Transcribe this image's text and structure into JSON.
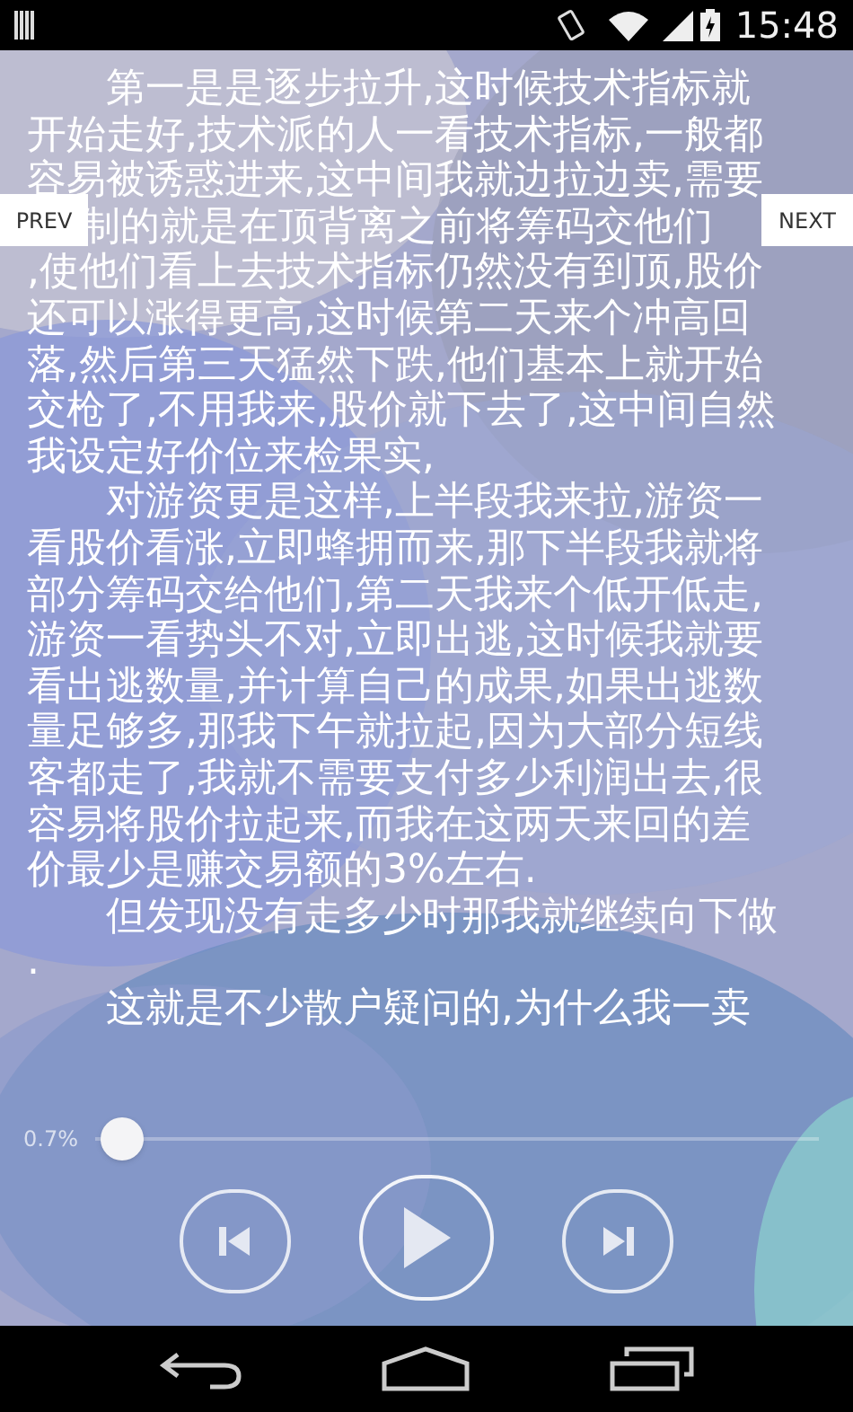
{
  "status_bar": {
    "time": "15:48"
  },
  "paragraphs": [
    {
      "lines": [
        {
          "kind": "line",
          "text": "第一是是逐步拉升,这时候技术指标就"
        },
        {
          "kind": "line",
          "text": "开始走好,技术派的人一看技术指标,一般都"
        },
        {
          "kind": "line",
          "text": "容易被诱惑进来,这中间我就边拉边卖,需要"
        },
        {
          "kind": "covered_line",
          "text": "制的就是在顶背离之前将筹码交他们"
        },
        {
          "kind": "line",
          "text": ",使他们看上去技术指标仍然没有到顶,股价"
        },
        {
          "kind": "line",
          "text": "还可以涨得更高,这时候第二天来个冲高回"
        },
        {
          "kind": "line",
          "text": "落,然后第三天猛然下跌,他们基本上就开始"
        },
        {
          "kind": "line",
          "text": "交枪了,不用我来,股价就下去了,这中间自然"
        },
        {
          "kind": "line",
          "text": "我设定好价位来检果实,"
        }
      ]
    },
    {
      "lines": [
        {
          "kind": "line",
          "text": "对游资更是这样,上半段我来拉,游资一"
        },
        {
          "kind": "line",
          "text": "看股价看涨,立即蜂拥而来,那下半段我就将"
        },
        {
          "kind": "line",
          "text": "部分筹码交给他们,第二天我来个低开低走,"
        },
        {
          "kind": "line",
          "text": "游资一看势头不对,立即出逃,这时候我就要"
        },
        {
          "kind": "line",
          "text": "看出逃数量,并计算自己的成果,如果出逃数"
        },
        {
          "kind": "line",
          "text": "量足够多,那我下午就拉起,因为大部分短线"
        },
        {
          "kind": "line",
          "text": "客都走了,我就不需要支付多少利润出去,很"
        },
        {
          "kind": "line",
          "text": "容易将股价拉起来,而我在这两天来回的差"
        },
        {
          "kind": "line",
          "text": "价最少是赚交易额的3%左右."
        }
      ]
    },
    {
      "lines": [
        {
          "kind": "line",
          "text": "但发现没有走多少时那我就继续向下做"
        },
        {
          "kind": "line",
          "text": "."
        }
      ]
    },
    {
      "lines": [
        {
          "kind": "line",
          "text": "这就是不少散户疑问的,为什么我一卖"
        }
      ]
    }
  ],
  "prev_button": "PREV",
  "next_button": "NEXT",
  "progress": {
    "reading": "0.7%",
    "level": 0.007
  }
}
